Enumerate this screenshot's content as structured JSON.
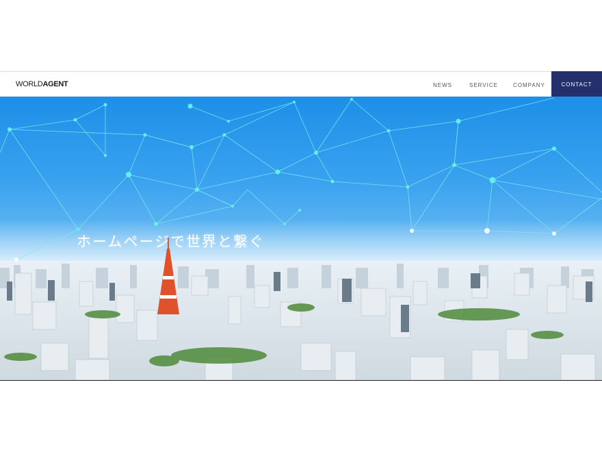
{
  "header": {
    "logo": {
      "part1": "WORLD",
      "part2": "AGENT"
    },
    "nav": [
      {
        "label": "NEWS"
      },
      {
        "label": "SERVICE"
      },
      {
        "label": "COMPANY"
      }
    ],
    "contact_label": "CONTACT"
  },
  "hero": {
    "tagline": "ホームページで世界と繋ぐ"
  },
  "colors": {
    "contact_bg": "#24306b",
    "sky_top": "#1d8fe8",
    "network_line": "#7fe8f0",
    "network_node": "#5ff0f0"
  }
}
